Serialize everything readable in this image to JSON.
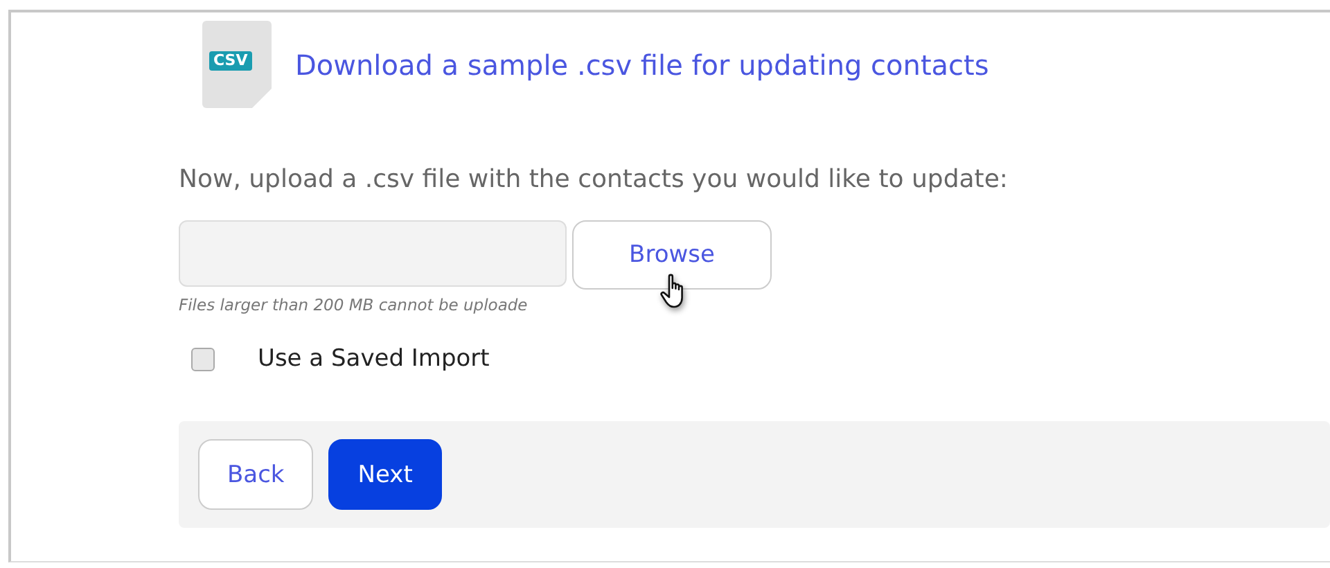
{
  "download_link": {
    "badge": "CSV",
    "label": "Download a sample .csv file for updating contacts"
  },
  "instruction": "Now, upload a .csv file with the contacts you would like to update:",
  "file_field": {
    "button": "Browse",
    "hint": "Files larger than 200 MB cannot be uploade"
  },
  "saved_import": {
    "label": "Use a Saved Import",
    "checked": false
  },
  "footer_buttons": [
    {
      "label": "Back",
      "kind": "secondary"
    },
    {
      "label": "Next",
      "kind": "primary"
    }
  ]
}
